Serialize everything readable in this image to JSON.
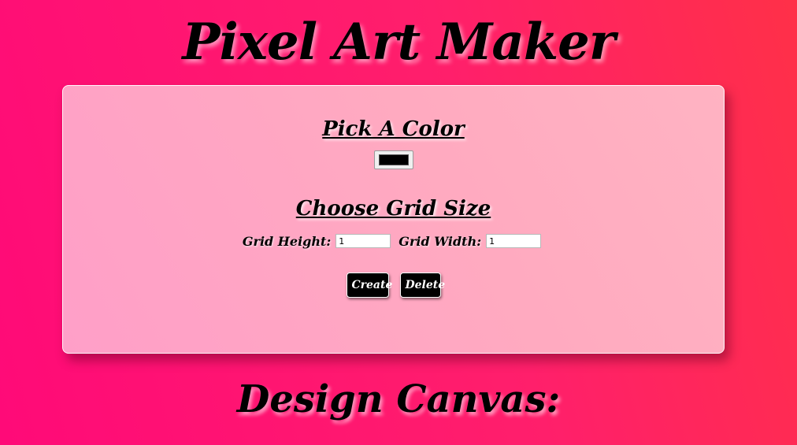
{
  "page": {
    "title": "Pixel Art Maker",
    "canvas_heading": "Design Canvas:"
  },
  "color_picker": {
    "heading": "Pick A Color",
    "value": "#000000"
  },
  "grid": {
    "heading": "Choose Grid Size",
    "height_label": "Grid Height:",
    "height_value": "1",
    "width_label": "Grid Width:",
    "width_value": "1"
  },
  "buttons": {
    "create_label": "Create",
    "delete_label": "Delete"
  },
  "colors": {
    "background_start": "#ff0a78",
    "background_end": "#ff3048",
    "panel": "#ffaac0",
    "button": "#000000",
    "text": "#000000"
  }
}
